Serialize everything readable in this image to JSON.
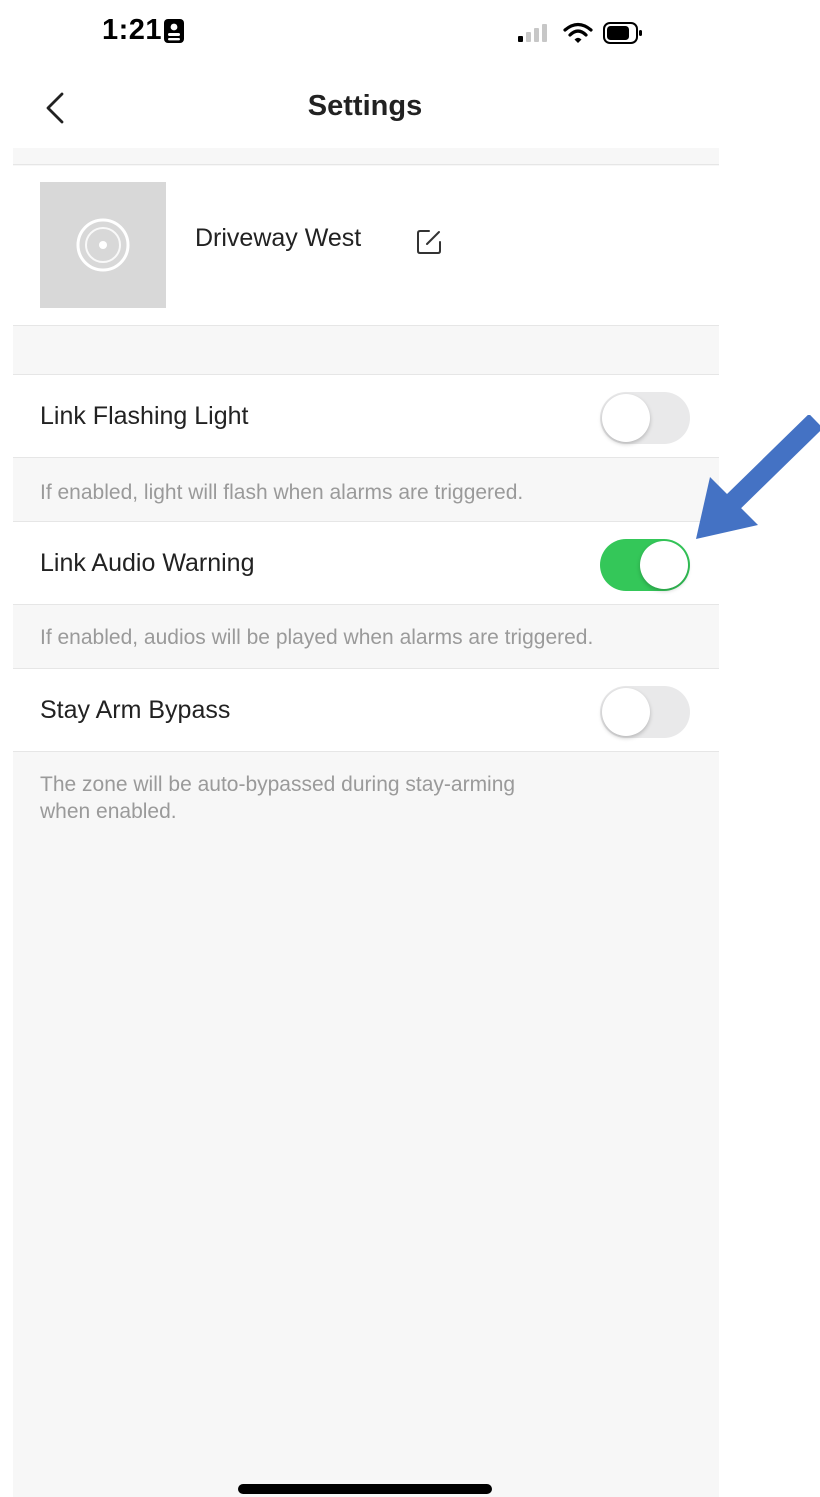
{
  "status_bar": {
    "time": "1:21",
    "icons": [
      "badge-icon",
      "signal-icon",
      "wifi-icon",
      "battery-icon"
    ]
  },
  "nav": {
    "title": "Settings",
    "back_icon": "chevron-left-icon"
  },
  "device": {
    "name": "Driveway West",
    "thumbnail_icon": "camera-sensor-icon",
    "edit_icon": "edit-icon"
  },
  "settings": [
    {
      "label": "Link Flashing Light",
      "enabled": false,
      "hint": "If enabled, light will flash when alarms are triggered."
    },
    {
      "label": "Link Audio Warning",
      "enabled": true,
      "hint": "If enabled, audios will be played when alarms are triggered."
    },
    {
      "label": "Stay Arm Bypass",
      "enabled": false,
      "hint_lines": [
        "The zone will be auto-bypassed during stay-arming",
        "when enabled."
      ]
    }
  ],
  "colors": {
    "toggle_on": "#34c759",
    "toggle_off": "#e9e9ea",
    "annotation_arrow": "#4472c4",
    "background": "#f7f7f7"
  }
}
